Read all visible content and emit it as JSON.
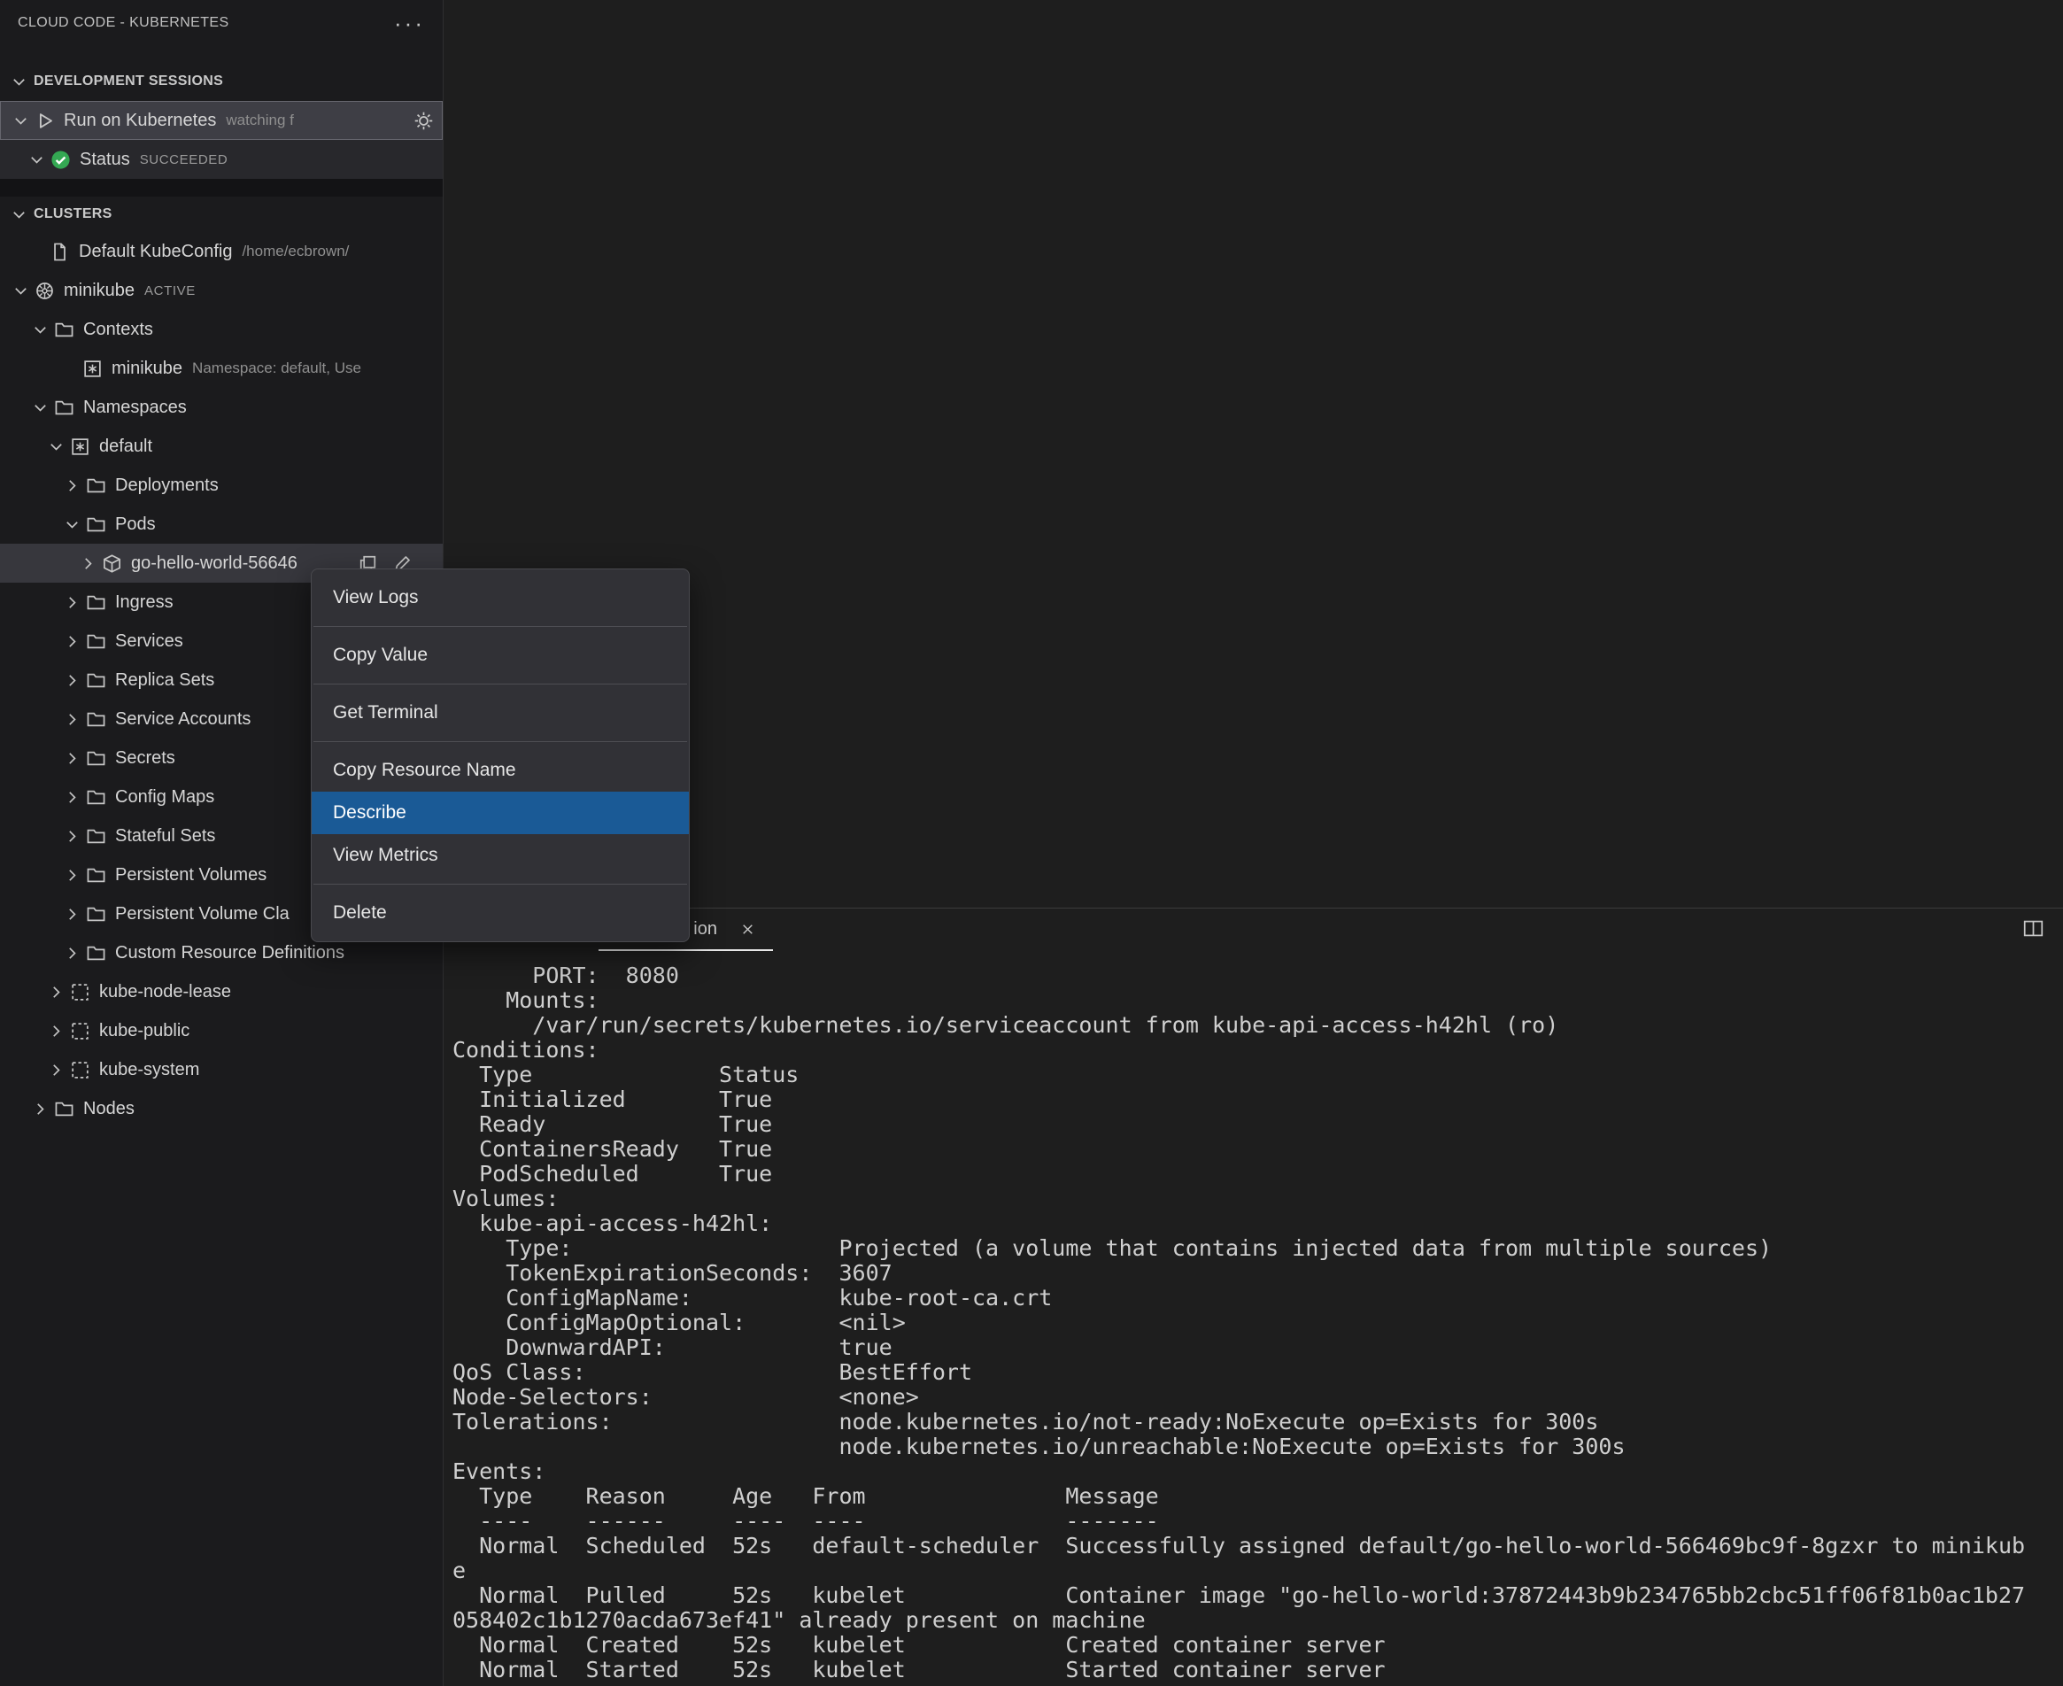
{
  "app": {
    "title": "CLOUD CODE - KUBERNETES",
    "more_icon": "···"
  },
  "colors": {
    "menu_highlight": "#1a5a96",
    "status_green": "#34a853",
    "selection_bg": "#37373d"
  },
  "sessions": {
    "header": "DEVELOPMENT SESSIONS",
    "run": {
      "label": "Run on Kubernetes",
      "desc": "watching f"
    },
    "status": {
      "label": "Status",
      "desc": "SUCCEEDED"
    }
  },
  "clusters": {
    "header": "CLUSTERS",
    "items": [
      {
        "label": "Default KubeConfig",
        "desc": "/home/ecbrown/"
      },
      {
        "label": "minikube",
        "desc": "ACTIVE"
      },
      {
        "label": "Contexts"
      },
      {
        "label": "minikube",
        "desc": "Namespace: default, Use"
      },
      {
        "label": "Namespaces"
      },
      {
        "label": "default"
      },
      {
        "label": "Deployments"
      },
      {
        "label": "Pods"
      },
      {
        "label": "go-hello-world-56646"
      },
      {
        "label": "Ingress"
      },
      {
        "label": "Services"
      },
      {
        "label": "Replica Sets"
      },
      {
        "label": "Service Accounts"
      },
      {
        "label": "Secrets"
      },
      {
        "label": "Config Maps"
      },
      {
        "label": "Stateful Sets"
      },
      {
        "label": "Persistent Volumes"
      },
      {
        "label": "Persistent Volume Cla"
      },
      {
        "label": "Custom Resource Definitions"
      },
      {
        "label": "kube-node-lease"
      },
      {
        "label": "kube-public"
      },
      {
        "label": "kube-system"
      },
      {
        "label": "Nodes"
      }
    ]
  },
  "context_menu": {
    "items": [
      "View Logs",
      "Copy Value",
      "Get Terminal",
      "Copy Resource Name",
      "Describe",
      "View Metrics",
      "Delete"
    ],
    "highlighted": "Describe"
  },
  "panel": {
    "tab_label": "ion",
    "lines": [
      "      PORT:  8080",
      "    Mounts:",
      "      /var/run/secrets/kubernetes.io/serviceaccount from kube-api-access-h42hl (ro)",
      "Conditions:",
      "  Type              Status",
      "  Initialized       True",
      "  Ready             True",
      "  ContainersReady   True",
      "  PodScheduled      True",
      "Volumes:",
      "  kube-api-access-h42hl:",
      "    Type:                    Projected (a volume that contains injected data from multiple sources)",
      "    TokenExpirationSeconds:  3607",
      "    ConfigMapName:           kube-root-ca.crt",
      "    ConfigMapOptional:       <nil>",
      "    DownwardAPI:             true",
      "QoS Class:                   BestEffort",
      "Node-Selectors:              <none>",
      "Tolerations:                 node.kubernetes.io/not-ready:NoExecute op=Exists for 300s",
      "                             node.kubernetes.io/unreachable:NoExecute op=Exists for 300s",
      "Events:",
      "  Type    Reason     Age   From               Message",
      "  ----    ------     ----  ----               -------",
      "  Normal  Scheduled  52s   default-scheduler  Successfully assigned default/go-hello-world-566469bc9f-8gzxr to minikub",
      "e",
      "  Normal  Pulled     52s   kubelet            Container image \"go-hello-world:37872443b9b234765bb2cbc51ff06f81b0ac1b27",
      "058402c1b1270acda673ef41\" already present on machine",
      "  Normal  Created    52s   kubelet            Created container server",
      "  Normal  Started    52s   kubelet            Started container server"
    ]
  }
}
